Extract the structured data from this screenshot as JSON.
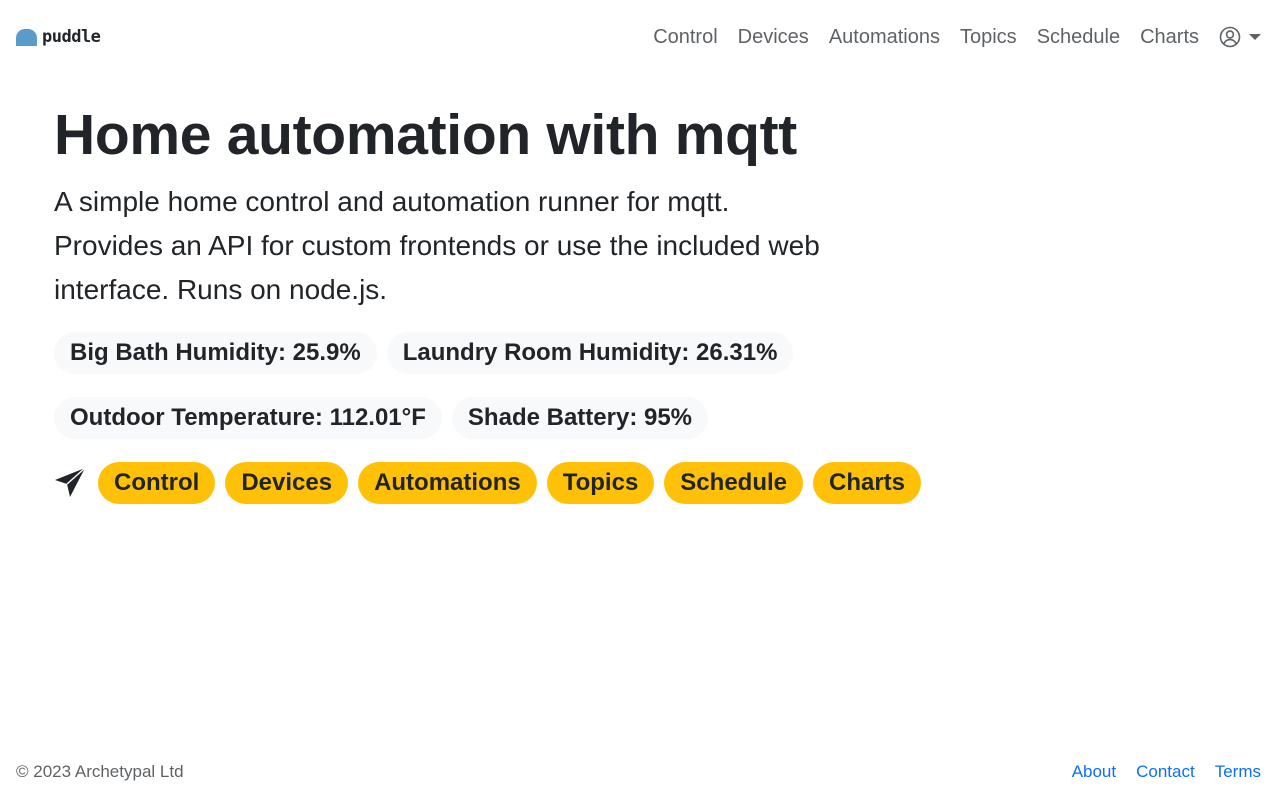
{
  "brand": {
    "name": "puddle",
    "logo_color": "#5b9bc9"
  },
  "nav": {
    "items": [
      {
        "label": "Control"
      },
      {
        "label": "Devices"
      },
      {
        "label": "Automations"
      },
      {
        "label": "Topics"
      },
      {
        "label": "Schedule"
      },
      {
        "label": "Charts"
      }
    ],
    "user_menu_icon": "person-circle-icon"
  },
  "hero": {
    "title": "Home automation with mqtt",
    "lead": "A simple home control and automation runner for mqtt. Provides an API for custom frontends or use the included web interface. Runs on node.js."
  },
  "sensors": [
    {
      "label": "Big Bath Humidity: 25.9%"
    },
    {
      "label": "Laundry Room Humidity: 26.31%"
    },
    {
      "label": "Outdoor Temperature: 112.01°F"
    },
    {
      "label": "Shade Battery: 95%"
    }
  ],
  "quick_links": {
    "icon": "send-icon",
    "accent": "#ffc107",
    "items": [
      {
        "label": "Control"
      },
      {
        "label": "Devices"
      },
      {
        "label": "Automations"
      },
      {
        "label": "Topics"
      },
      {
        "label": "Schedule"
      },
      {
        "label": "Charts"
      }
    ]
  },
  "footer": {
    "copyright": "© 2023 Archetypal Ltd",
    "links": [
      {
        "label": "About"
      },
      {
        "label": "Contact"
      },
      {
        "label": "Terms"
      }
    ],
    "link_color": "#0d6efd"
  }
}
